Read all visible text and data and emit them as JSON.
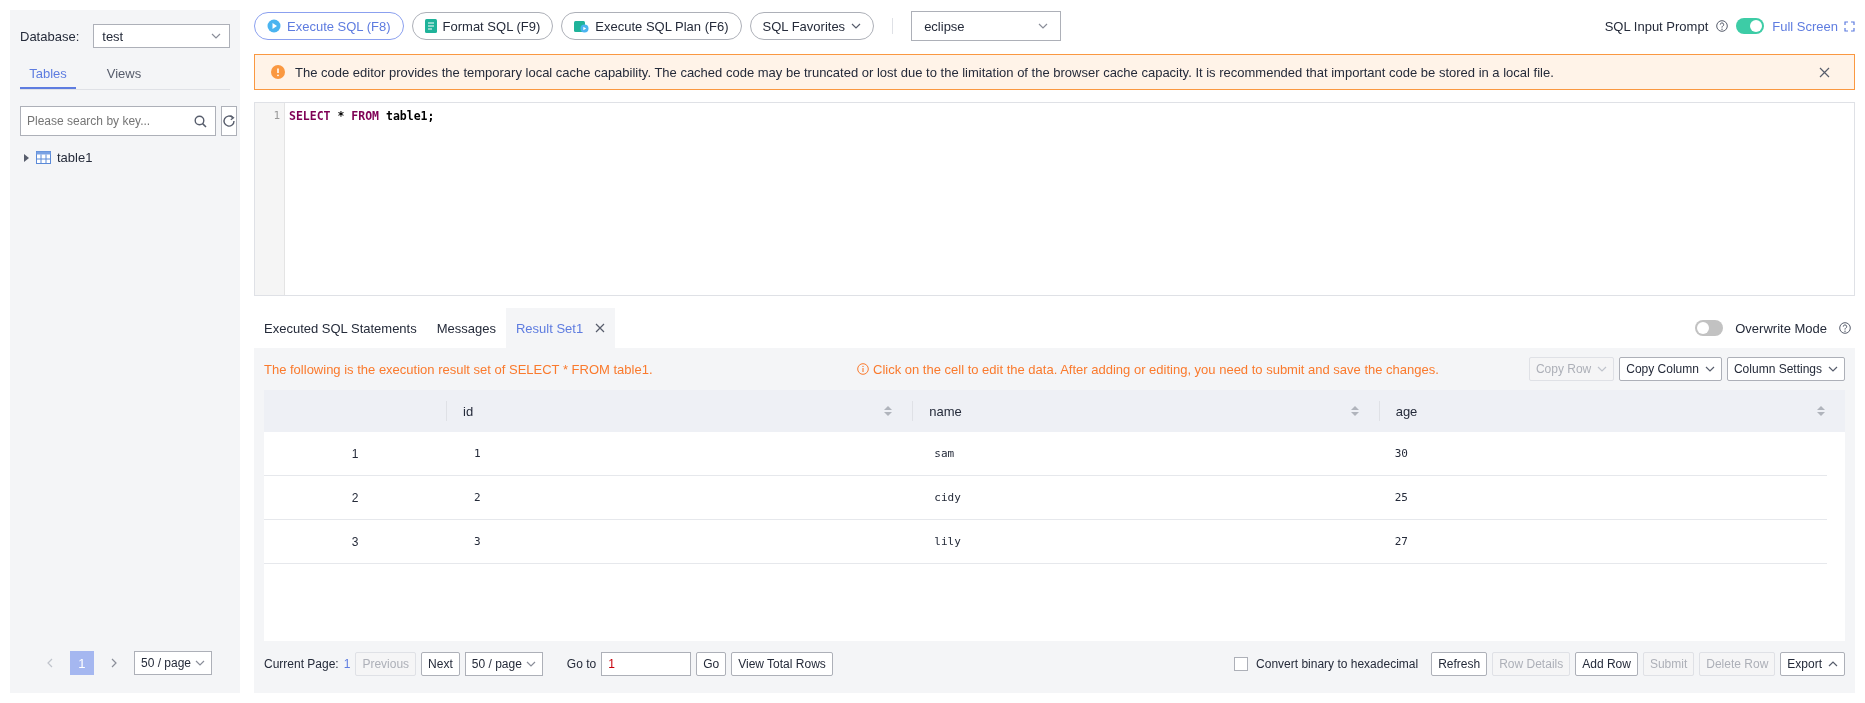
{
  "sidebar": {
    "database_label": "Database:",
    "database_value": "test",
    "tabs": [
      {
        "label": "Tables",
        "selected": true
      },
      {
        "label": "Views",
        "selected": false
      }
    ],
    "search": {
      "placeholder": "Please search by key..."
    },
    "tree": [
      {
        "label": "table1",
        "expanded": false
      }
    ],
    "pagination": {
      "pages": [
        {
          "label": "1",
          "selected": true
        }
      ],
      "page_size": "50 / page"
    }
  },
  "toolbar": {
    "buttons": [
      {
        "label": "Execute SQL (F8)",
        "kind": "execute"
      },
      {
        "label": "Format SQL (F9)",
        "kind": "format"
      },
      {
        "label": "Execute SQL Plan (F6)",
        "kind": "plan"
      },
      {
        "label": "SQL Favorites",
        "kind": "dropdown"
      }
    ],
    "theme_select": "eclipse",
    "input_prompt_label": "SQL Input Prompt",
    "input_prompt_on": true,
    "full_screen": "Full Screen"
  },
  "alert": "The code editor provides the temporary local cache capability. The cached code may be truncated or lost due to the limitation of the browser cache capacity. It is recommended that important code be stored in a local file.",
  "editor": {
    "lines": [
      {
        "number": "1",
        "tokens": [
          {
            "text": "SELECT",
            "kind": "keyword"
          },
          {
            "text": " * ",
            "kind": "plain"
          },
          {
            "text": "FROM",
            "kind": "keyword"
          },
          {
            "text": " table1;",
            "kind": "plain"
          }
        ]
      }
    ]
  },
  "result_tabs": [
    {
      "label": "Executed SQL Statements",
      "selected": false,
      "closable": false
    },
    {
      "label": "Messages",
      "selected": false,
      "closable": false
    },
    {
      "label": "Result Set1",
      "selected": true,
      "closable": true
    }
  ],
  "overwrite_mode": {
    "label": "Overwrite Mode",
    "on": false
  },
  "result": {
    "summary": "The following is the execution result set of SELECT * FROM table1.",
    "hint": "Click on the cell to edit the data. After adding or editing, you need to submit and save the changes.",
    "actions": [
      {
        "label": "Copy Row",
        "disabled": true
      },
      {
        "label": "Copy Column",
        "disabled": false
      },
      {
        "label": "Column Settings",
        "disabled": false
      }
    ],
    "columns": [
      "id",
      "name",
      "age"
    ],
    "rows": [
      {
        "index": "1",
        "cells": [
          "1",
          "sam",
          "30"
        ]
      },
      {
        "index": "2",
        "cells": [
          "2",
          "cidy",
          "25"
        ]
      },
      {
        "index": "3",
        "cells": [
          "3",
          "lily",
          "27"
        ]
      }
    ]
  },
  "footer": {
    "current_page_label": "Current Page:",
    "current_page": "1",
    "pager": [
      {
        "label": "Previous",
        "disabled": true
      },
      {
        "label": "Next",
        "disabled": false
      }
    ],
    "page_size": "50 / page",
    "goto_label": "Go to",
    "goto_value": "1",
    "go": "Go",
    "view_total": "View Total Rows",
    "convert": {
      "label": "Convert binary to hexadecimal",
      "checked": false
    },
    "buttons": [
      {
        "label": "Refresh",
        "disabled": false
      },
      {
        "label": "Row Details",
        "disabled": true
      },
      {
        "label": "Add Row",
        "disabled": false
      },
      {
        "label": "Submit",
        "disabled": true
      },
      {
        "label": "Delete Row",
        "disabled": true
      }
    ],
    "export": "Export"
  }
}
